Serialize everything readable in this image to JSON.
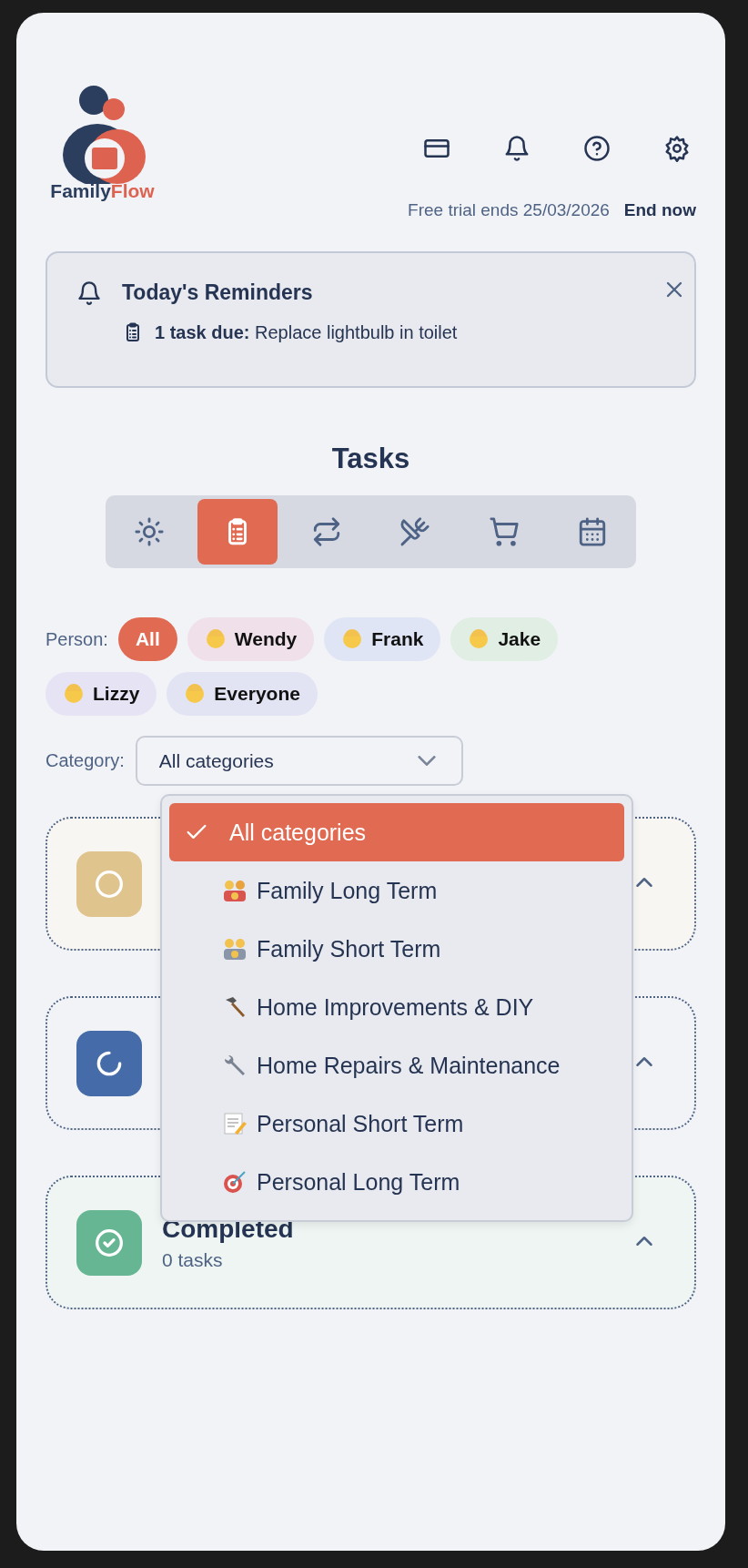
{
  "logo": {
    "first": "Family",
    "second": "Flow"
  },
  "trial": {
    "text": "Free trial ends 25/03/2026",
    "action": "End now"
  },
  "reminders": {
    "title": "Today's Reminders",
    "line": "**1 task due:** Replace lightbulb in toilet"
  },
  "section_title": "Tasks",
  "tabs": [
    {
      "selected": false
    },
    {
      "selected": true
    },
    {
      "selected": false
    },
    {
      "selected": false
    },
    {
      "selected": false
    },
    {
      "selected": false
    }
  ],
  "person_filter": {
    "label": "Person:",
    "people": [
      {
        "name": "All",
        "selected": true,
        "color": "#e06a52"
      },
      {
        "name": "Wendy",
        "selected": false,
        "color": "#f0e0ea"
      },
      {
        "name": "Frank",
        "selected": false,
        "color": "#dfe5f4"
      },
      {
        "name": "Jake",
        "selected": false,
        "color": "#e0eee4"
      },
      {
        "name": "Lizzy",
        "selected": false,
        "color": "#e6e3f4"
      },
      {
        "name": "Everyone",
        "selected": false,
        "color": "#e2e3f3"
      }
    ]
  },
  "category_filter": {
    "label": "Category:",
    "value": "All categories",
    "expanded": true,
    "options": [
      {
        "label": "All categories",
        "selected": true
      },
      {
        "label": "Family Long Term",
        "selected": false
      },
      {
        "label": "Family Short Term",
        "selected": false
      },
      {
        "label": "Home Improvements & DIY",
        "selected": false
      },
      {
        "label": "Home Repairs & Maintenance",
        "selected": false
      },
      {
        "label": "Personal Short Term",
        "selected": false
      },
      {
        "label": "Personal Long Term",
        "selected": false
      }
    ]
  },
  "groups": [
    {
      "kind": "pending",
      "expanded": true
    },
    {
      "kind": "in_progress",
      "expanded": true
    },
    {
      "kind": "completed",
      "title": "Completed",
      "count": "0 tasks",
      "expanded": true
    }
  ]
}
